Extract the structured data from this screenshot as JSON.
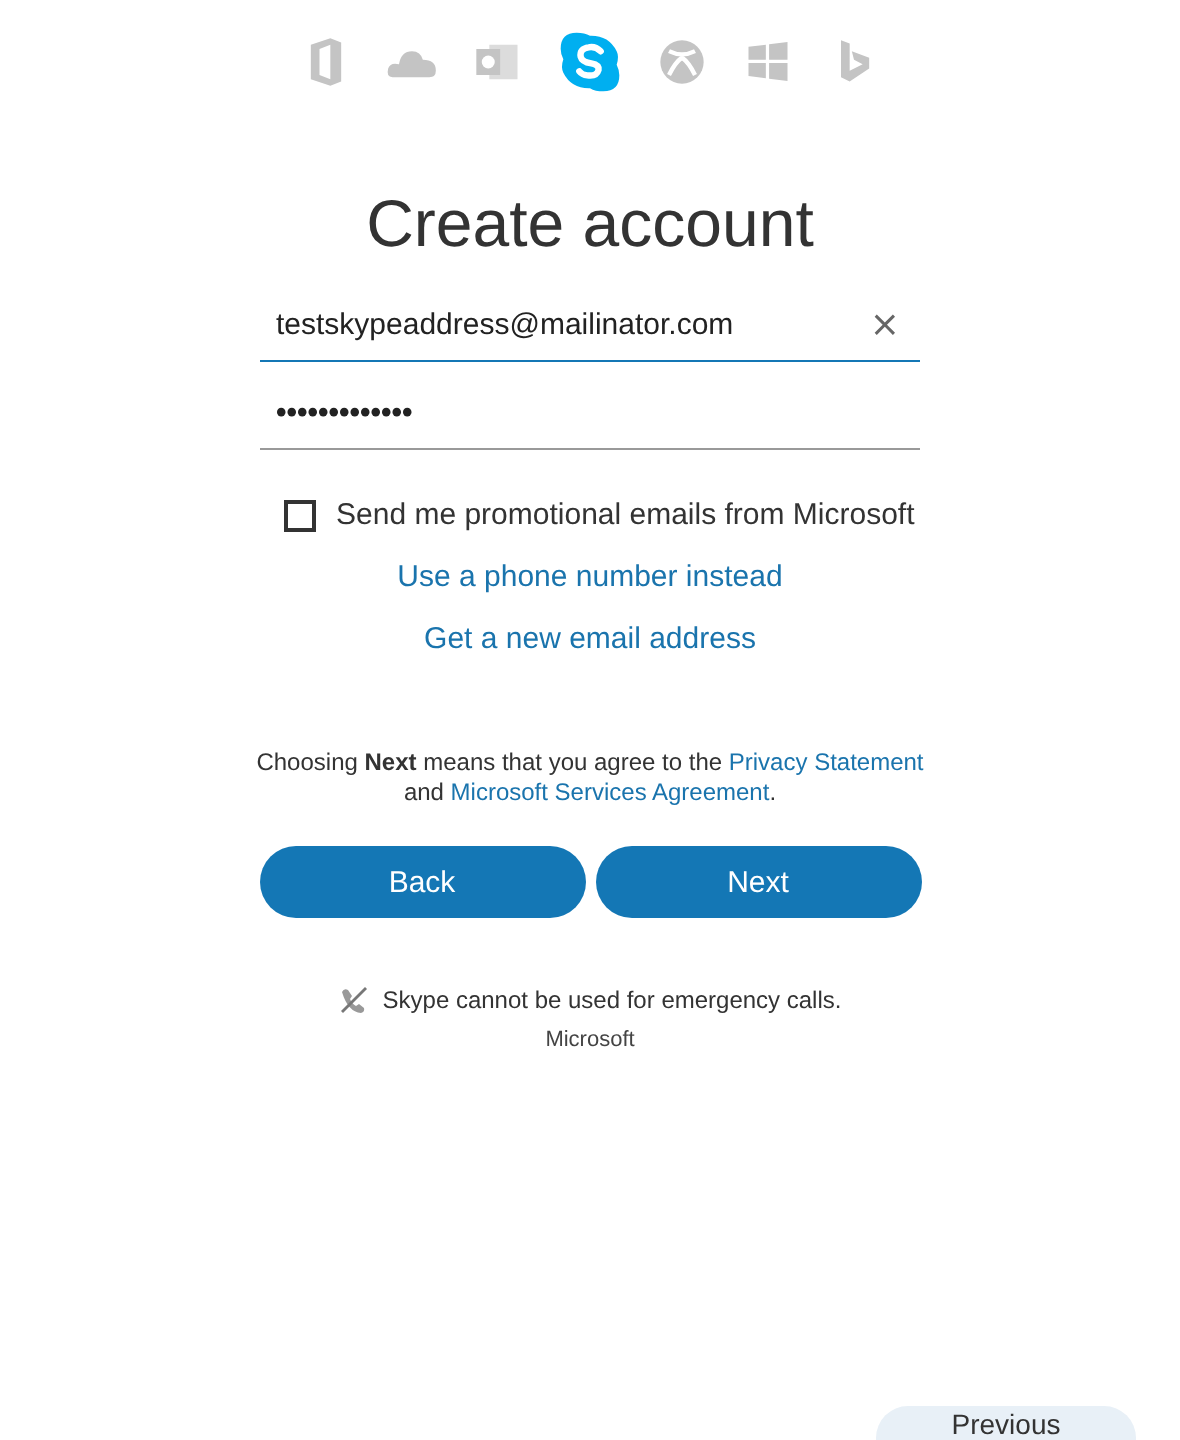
{
  "apps": [
    {
      "kind": "office",
      "selected": false
    },
    {
      "kind": "cloud",
      "selected": false
    },
    {
      "kind": "mail",
      "selected": false
    },
    {
      "kind": "skype",
      "selected": true
    },
    {
      "kind": "xbox",
      "selected": false
    },
    {
      "kind": "windows",
      "selected": false
    },
    {
      "kind": "bing",
      "selected": false
    }
  ],
  "title": "Create account",
  "email": {
    "value": "testskypeaddress@mailinator.com",
    "focused": true,
    "clear": "×"
  },
  "password": {
    "value": "•••••••••••••",
    "focused": false
  },
  "promo": {
    "label": "Send me promotional emails from Microsoft",
    "checked": false
  },
  "links": [
    "Use a phone number instead",
    "Get a new email address"
  ],
  "legal": [
    {
      "kind": "text",
      "text": "Choosing **Next** means that you agree to the "
    },
    {
      "kind": "link",
      "text": "Privacy Statement"
    },
    {
      "kind": "text",
      "text": " and "
    },
    {
      "kind": "link",
      "text": "Microsoft Services Agreement"
    },
    {
      "kind": "text",
      "text": "."
    }
  ],
  "buttons": [
    "Back",
    "Next"
  ],
  "notice": "Skype cannot be used for emergency calls.",
  "footer": "Microsoft",
  "previous": "Previous"
}
